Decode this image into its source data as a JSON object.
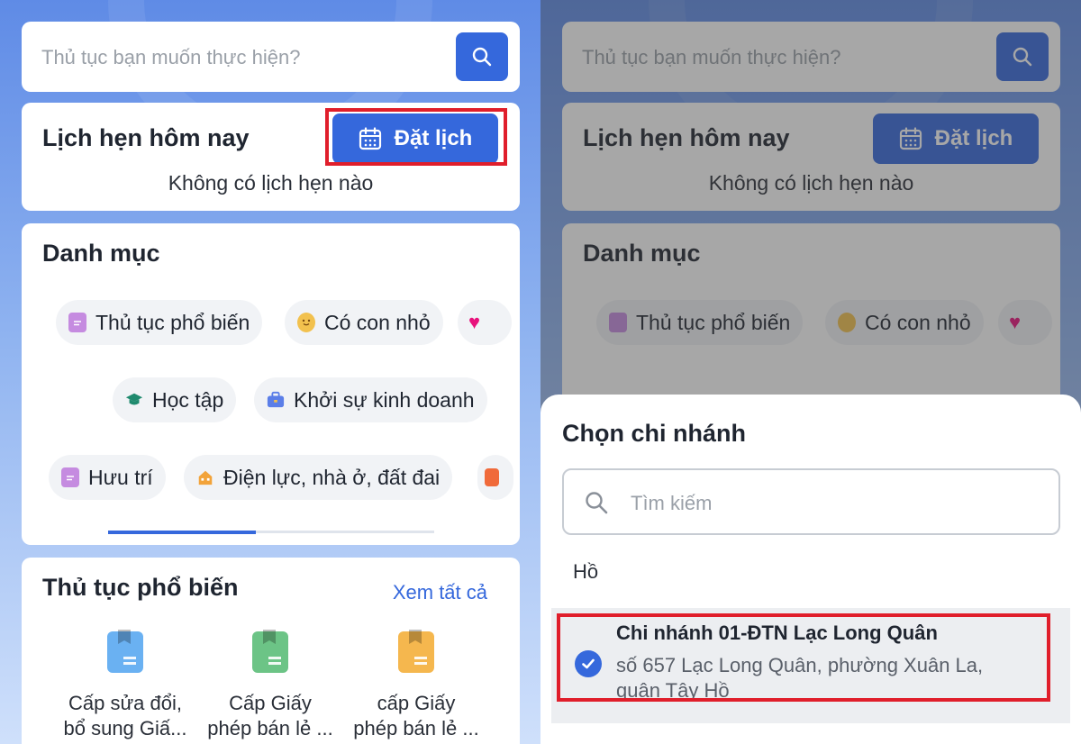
{
  "search": {
    "placeholder": "Thủ tục bạn muốn thực hiện?"
  },
  "appointment": {
    "title": "Lịch hẹn hôm nay",
    "book_label": "Đặt lịch",
    "empty_text": "Không có lịch hẹn nào"
  },
  "categories": {
    "title": "Danh mục",
    "items": [
      {
        "label": "Thủ tục phổ biến",
        "icon": "document-icon",
        "color": "#c58be0"
      },
      {
        "label": "Có con nhỏ",
        "icon": "baby-face-icon",
        "color": "#f2c14e"
      },
      {
        "label": "",
        "icon": "heart-icon",
        "color": "#e8127c"
      },
      {
        "label": "Học tập",
        "icon": "graduation-cap-icon",
        "color": "#1f8a6e"
      },
      {
        "label": "Khởi sự kinh doanh",
        "icon": "briefcase-icon",
        "color": "#5b7ee8"
      },
      {
        "label": "Hưu trí",
        "icon": "document-icon",
        "color": "#c58be0"
      },
      {
        "label": "Điện lực, nhà ở, đất đai",
        "icon": "house-icon",
        "color": "#f2a33a"
      },
      {
        "label": "",
        "icon": "sofa-icon",
        "color": "#f06a3a"
      }
    ]
  },
  "popular": {
    "title": "Thủ tục phổ biến",
    "see_all": "Xem tất cả",
    "items": [
      {
        "line1": "Cấp sửa đổi,",
        "line2": "bổ sung Giấ...",
        "color": "#6ab1f2"
      },
      {
        "line1": "Cấp Giấy",
        "line2": "phép bán lẻ ...",
        "color": "#6cc486"
      },
      {
        "line1": "cấp Giấy",
        "line2": "phép bán lẻ ...",
        "color": "#f5b74e"
      }
    ]
  },
  "branch_sheet": {
    "title": "Chọn chi nhánh",
    "search_placeholder": "Tìm kiếm",
    "partial_text": "Hồ",
    "selected_branch": {
      "name": "Chi nhánh 01-ĐTN Lạc Long Quân",
      "address_line1": "số 657 Lạc Long Quân, phường Xuân La,",
      "address_line2": "quận Tây Hồ"
    }
  },
  "colors": {
    "accent": "#3568dc",
    "highlight": "#e01e2b"
  }
}
